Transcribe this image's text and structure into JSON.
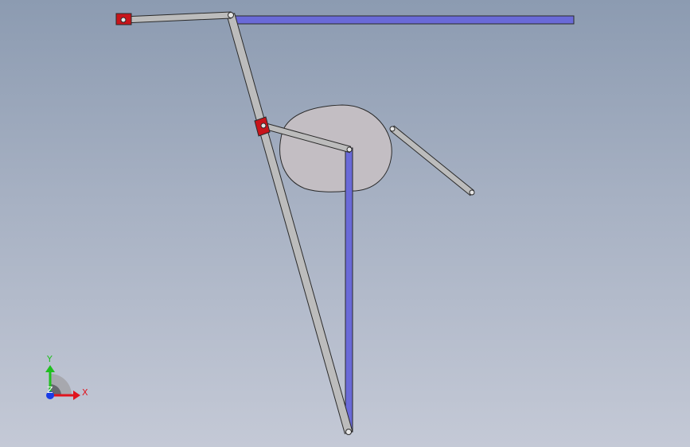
{
  "triad": {
    "x_label": "X",
    "y_label": "Y",
    "z_label": "Z",
    "x_color": "#e0141e",
    "y_color": "#1fbf1f",
    "z_color": "#1a3ce6"
  },
  "colors": {
    "link_fill": "#bcbcbc",
    "link_stroke": "#2a2a2a",
    "slider_rail": "#6a6ad8",
    "slider_block": "#c8141a",
    "cam_fill": "#c3bec3"
  },
  "scene_parts": [
    "cam",
    "horizontal-rail",
    "vertical-rail",
    "long-link",
    "crank-link",
    "top-link",
    "follower-link",
    "top-slider-block",
    "middle-slider-block"
  ]
}
